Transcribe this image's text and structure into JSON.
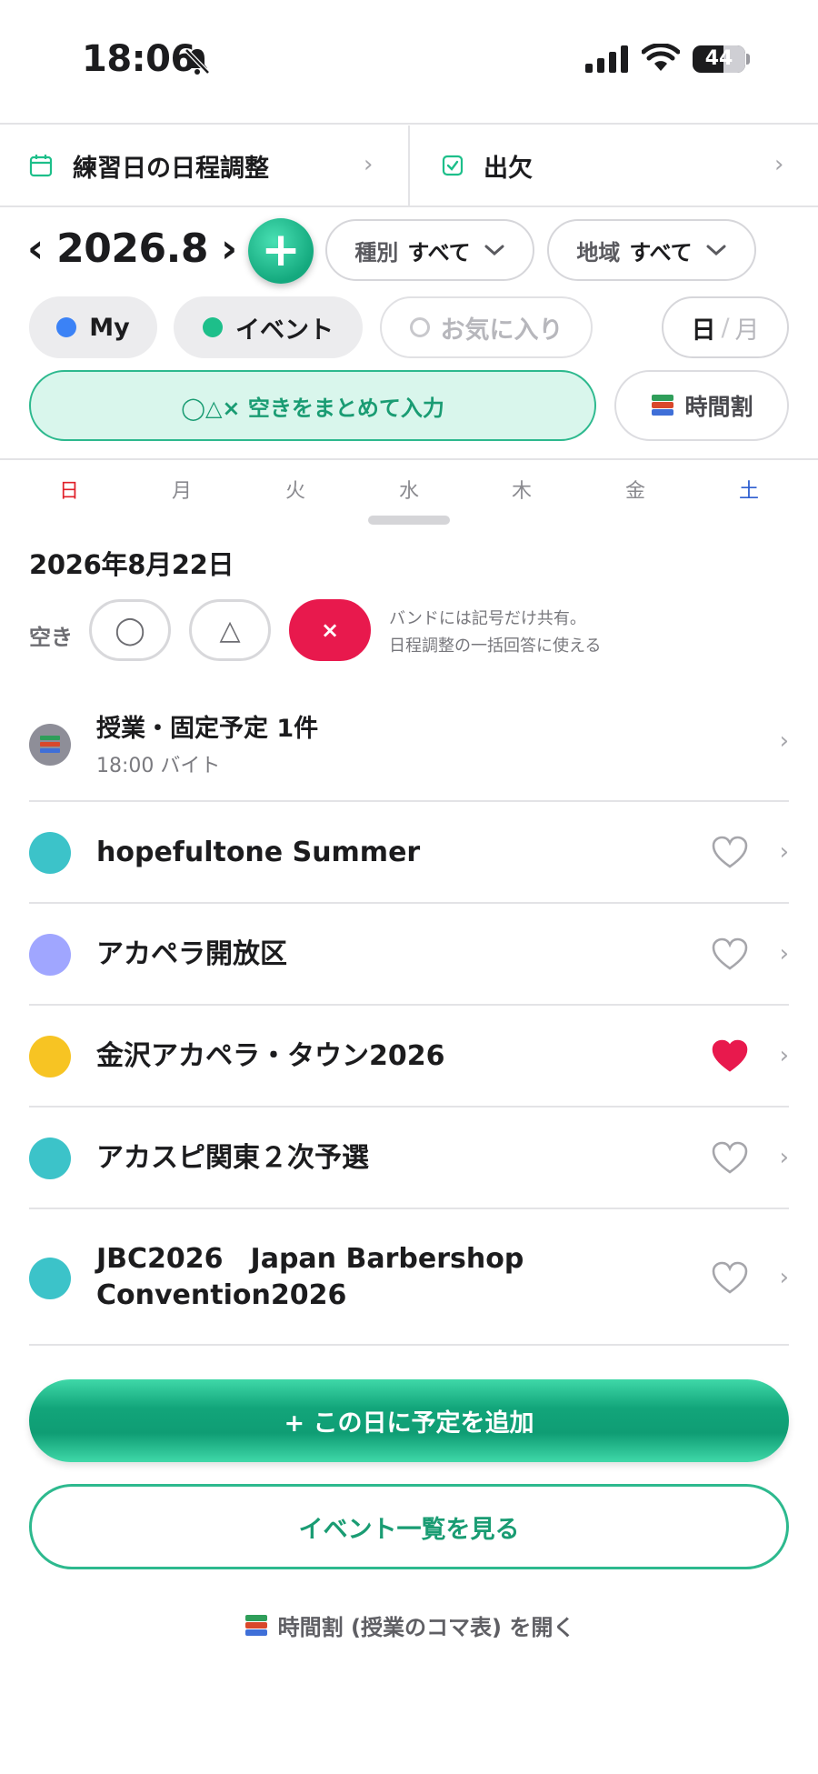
{
  "status_bar": {
    "time": "18:06",
    "battery": "44"
  },
  "top_tabs": [
    {
      "label": "練習日の日程調整",
      "icon": "calendar-icon"
    },
    {
      "label": "出欠",
      "icon": "checkbox-icon"
    }
  ],
  "month_nav": {
    "prev": "‹",
    "label": "2026.8",
    "next": "›",
    "add": "+"
  },
  "filters": [
    {
      "key": "種別",
      "value": "すべて"
    },
    {
      "key": "地域",
      "value": "すべて"
    }
  ],
  "chips": [
    {
      "label": "My",
      "color": "#3b82f6",
      "active": true
    },
    {
      "label": "イベント",
      "color": "#1dbf8a",
      "active": true
    },
    {
      "label": "お気に入り",
      "active": false
    }
  ],
  "view_toggle": {
    "day": "日",
    "sep": "/",
    "month": "月",
    "selected": "日"
  },
  "actions": {
    "bulk_input": "◯△× 空きをまとめて入力",
    "timetable": "時間割"
  },
  "weekdays": [
    "日",
    "月",
    "火",
    "水",
    "木",
    "金",
    "土"
  ],
  "weekday_colors": {
    "sunday": "#e0202a",
    "saturday": "#2f5fd0",
    "default": "#8a8a8f"
  },
  "day_detail": {
    "date": "2026年8月22日",
    "availability_label": "空き",
    "options": [
      "◯",
      "△",
      "×"
    ],
    "selected": "×",
    "note_line1": "バンドには記号だけ共有。",
    "note_line2": "日程調整の一括回答に使える"
  },
  "schedule": {
    "title": "授業・固定予定 1件",
    "subtitle": "18:00 バイト"
  },
  "events": [
    {
      "title": "hopefultone Summer",
      "color": "#3cc3c9",
      "favorite": false
    },
    {
      "title": "アカペラ開放区",
      "color": "#a0a6ff",
      "favorite": false
    },
    {
      "title": "金沢アカペラ・タウン2026",
      "color": "#f7c423",
      "favorite": true
    },
    {
      "title": "アカスピ関東２次予選",
      "color": "#3cc3c9",
      "favorite": false
    },
    {
      "title_line1": "JBC2026　Japan Barbershop",
      "title_line2": "Convention2026",
      "color": "#3cc3c9",
      "favorite": false
    }
  ],
  "bottom": {
    "add_button": "+ この日に予定を追加",
    "events_button": "イベント一覧を見る",
    "timetable_link": "時間割 (授業のコマ表) を開く"
  },
  "colors": {
    "accent": "#1a9c73",
    "accent_light": "#d9f6ec",
    "favorite": "#e8194d",
    "unavailable": "#e8194d"
  }
}
